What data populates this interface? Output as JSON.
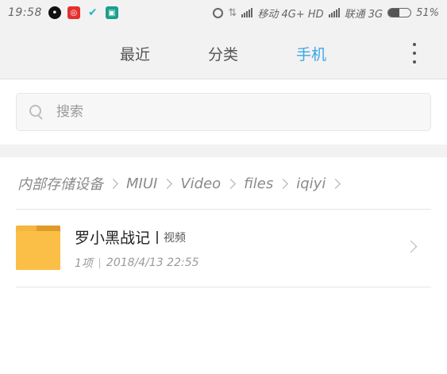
{
  "status_bar": {
    "time": "19:58",
    "carrier1": "移动 4G+ HD",
    "carrier2": "联通 3G",
    "battery_text": "51%",
    "battery_level": 0.51,
    "icons": [
      "qq-icon",
      "netease-music-icon",
      "check-app-icon",
      "reader-app-icon",
      "alarm-icon",
      "data-transfer-icon",
      "signal-icon"
    ]
  },
  "top_nav": {
    "tabs": [
      {
        "label": "最近"
      },
      {
        "label": "分类"
      },
      {
        "label": "手机"
      }
    ],
    "active_tab": "手机",
    "accent_color": "#3ba7e6",
    "more_icon": "more-vertical-icon"
  },
  "search": {
    "placeholder": "搜索"
  },
  "breadcrumb": {
    "items": [
      "内部存储设备",
      "MIUI",
      "Video",
      "files",
      "iqiyi"
    ]
  },
  "file_list": [
    {
      "name": "罗小黑战记",
      "tag": "视频",
      "count": "1项",
      "modified": "2018/4/13 22:55",
      "icon": "folder-icon"
    }
  ]
}
